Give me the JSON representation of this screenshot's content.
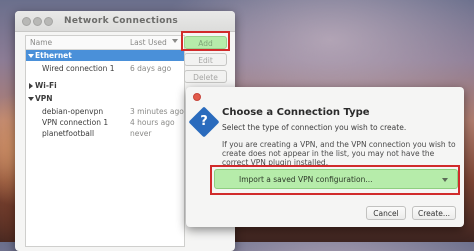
{
  "nm": {
    "title": "Network Connections",
    "columns": {
      "name": "Name",
      "last_used": "Last Used"
    },
    "groups": [
      {
        "label": "Ethernet",
        "items": [
          {
            "name": "Wired connection 1",
            "used": "6 days ago"
          }
        ]
      },
      {
        "label": "Wi-Fi",
        "items": []
      },
      {
        "label": "VPN",
        "items": [
          {
            "name": "debian-openvpn",
            "used": "3 minutes ago"
          },
          {
            "name": "VPN connection 1",
            "used": "4 hours ago"
          },
          {
            "name": "planetfootball",
            "used": "never"
          }
        ]
      }
    ],
    "buttons": {
      "add": "Add",
      "edit": "Edit",
      "delete": "Delete"
    }
  },
  "dialog": {
    "icon": "question-icon",
    "icon_glyph": "?",
    "title": "Choose a Connection Type",
    "subtitle": "Select the type of connection you wish to create.",
    "body": "If you are creating a VPN, and the VPN connection you wish to create does not appear in the list, you may not have the correct VPN plugin installed.",
    "selected_type": "Import a saved VPN configuration...",
    "cancel": "Cancel",
    "create": "Create..."
  },
  "colors": {
    "selection": "#4a90d9",
    "highlight": "#d12b2b",
    "combo_bg": "#b6ecaa",
    "icon_blue": "#2a6bbd"
  }
}
